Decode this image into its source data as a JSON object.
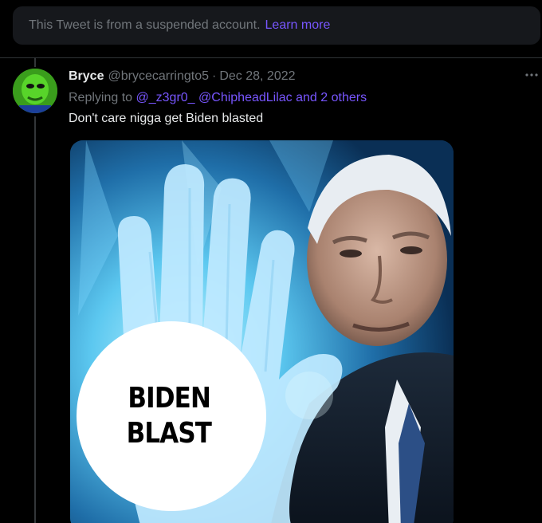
{
  "suspended_notice": {
    "message": "This Tweet is from a suspended account.",
    "link_label": "Learn more"
  },
  "tweet": {
    "author": {
      "display_name": "Bryce",
      "handle": "@brycecarringto5"
    },
    "separator": "·",
    "date": "Dec 28, 2022",
    "replying": {
      "prefix": "Replying to",
      "mentions": [
        "@_z3gr0_",
        "@ChipheadLilac"
      ],
      "others": "and 2 others"
    },
    "text": "Don't care nigga get Biden blasted",
    "more_icon": "more-horizontal-icon",
    "media": {
      "caption_lines": [
        "BIDEN",
        "BLAST"
      ]
    }
  },
  "colors": {
    "background": "#000000",
    "banner": "#16181c",
    "accent_link": "#7856ff",
    "secondary_text": "#71767b",
    "primary_text": "#e7e9ea"
  }
}
